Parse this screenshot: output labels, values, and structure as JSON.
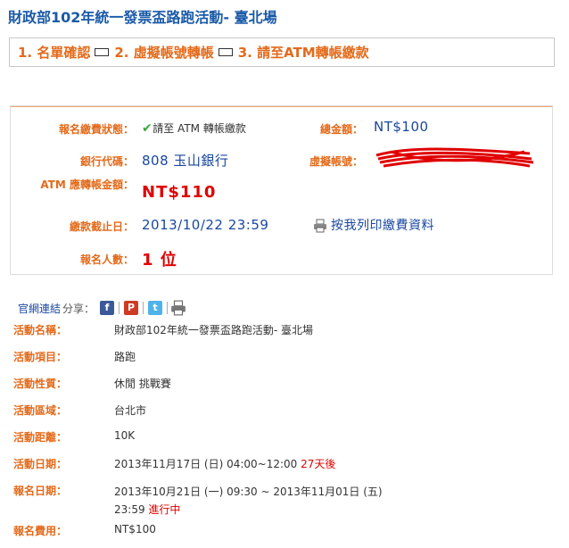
{
  "title": "財政部102年統一發票盃路跑活動- 臺北場",
  "steps": {
    "step1": "1. 名單確認",
    "step2": "2. 虛擬帳號轉帳",
    "step3": "3. 請至ATM轉帳繳款"
  },
  "summary": {
    "status_label": "報名繳費狀態：",
    "status_value": "請至 ATM 轉帳繳款",
    "total_label": "總金額：",
    "total_value": "NT$100",
    "bank_label": "銀行代碼：",
    "bank_value": "808 玉山銀行",
    "virtual_label": "虛擬帳號：",
    "atm_label": "ATM 應轉帳金額：",
    "atm_value": "NT$110",
    "deadline_label": "繳款截止日：",
    "deadline_value": "2013/10/22 23:59",
    "print_link": "按我列印繳費資料",
    "count_label": "報名人數：",
    "count_value": "1 位"
  },
  "share": {
    "official_link": "官網連結",
    "share_label": "分享：",
    "icons": [
      "facebook-icon",
      "plurk-icon",
      "twitter-icon",
      "print-icon"
    ]
  },
  "details": [
    {
      "key": "活動名稱：",
      "value": "財政部102年統一發票盃路跑活動- 臺北場"
    },
    {
      "key": "活動項目：",
      "value": "路跑"
    },
    {
      "key": "活動性質：",
      "value": "休閒 挑戰賽"
    },
    {
      "key": "活動區域：",
      "value": "台北市"
    },
    {
      "key": "活動距離：",
      "value": "10K"
    },
    {
      "key": "活動日期：",
      "value": "2013年11月17日 (日) 04:00~12:00 ",
      "extra": "27天後"
    },
    {
      "key": "報名日期：",
      "value": "2013年10月21日 (一) 09:30 ~ 2013年11月01日 (五)",
      "value2": "23:59 ",
      "extra": "進行中"
    },
    {
      "key": "報名費用：",
      "value": "NT$100"
    }
  ],
  "colors": {
    "accent": "#e36a1a",
    "link": "#1a47a0",
    "alert": "#e00000",
    "title": "#1a5aa8"
  }
}
